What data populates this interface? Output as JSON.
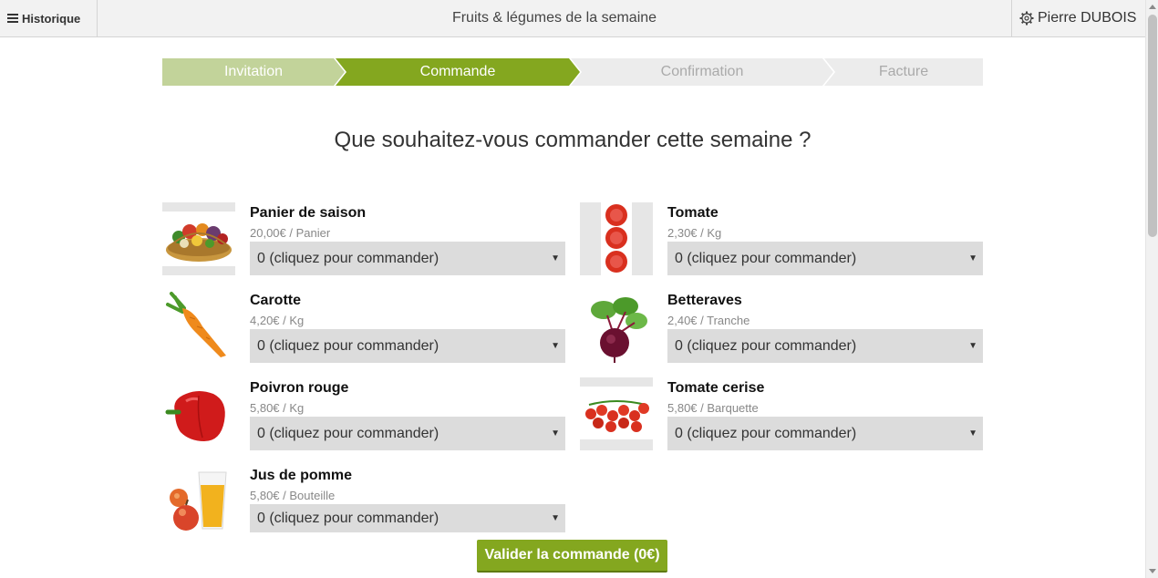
{
  "header": {
    "history_label": "Historique",
    "title": "Fruits & légumes de la semaine",
    "user_name": "Pierre DUBOIS"
  },
  "steps": [
    "Invitation",
    "Commande",
    "Confirmation",
    "Facture"
  ],
  "question": "Que souhaitez-vous commander cette semaine ?",
  "products": [
    {
      "name": "Panier de saison",
      "price": "20,00€ / Panier",
      "qty": "0 (cliquez pour commander)",
      "icon": "basket-icon"
    },
    {
      "name": "Tomate",
      "price": "2,30€ / Kg",
      "qty": "0 (cliquez pour commander)",
      "icon": "tomato-icon"
    },
    {
      "name": "Carotte",
      "price": "4,20€ / Kg",
      "qty": "0 (cliquez pour commander)",
      "icon": "carrot-icon"
    },
    {
      "name": "Betteraves",
      "price": "2,40€ / Tranche",
      "qty": "0 (cliquez pour commander)",
      "icon": "beet-icon"
    },
    {
      "name": "Poivron rouge",
      "price": "5,80€ / Kg",
      "qty": "0 (cliquez pour commander)",
      "icon": "pepper-icon"
    },
    {
      "name": "Tomate cerise",
      "price": "5,80€ / Barquette",
      "qty": "0 (cliquez pour commander)",
      "icon": "cherry-tomato-icon"
    },
    {
      "name": "Jus de pomme",
      "price": "5,80€ / Bouteille",
      "qty": "0 (cliquez pour commander)",
      "icon": "apple-juice-icon"
    }
  ],
  "validate_label": "Valider la commande (0€)",
  "colors": {
    "accent": "#84a71f",
    "accent_light": "#c2d39a",
    "step_inactive": "#ececec"
  }
}
